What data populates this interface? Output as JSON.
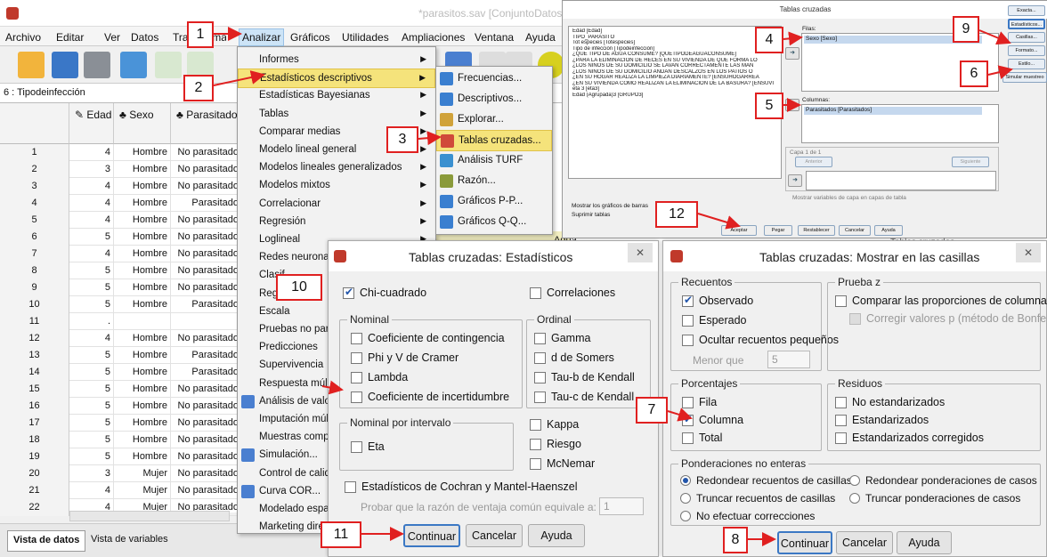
{
  "spss": {
    "title": "*parasitos.sav [ConjuntoDatos1] - IBM S",
    "menu": [
      "Archivo",
      "Editar",
      "Ver",
      "Datos",
      "Transformar",
      "Analizar",
      "Gráficos",
      "Utilidades",
      "Ampliaciones",
      "Ventana",
      "Ayuda"
    ],
    "var_ref": "6 : Tipodeinfección",
    "columns": [
      "Edad",
      "Sexo",
      "Parasitado"
    ],
    "rows": [
      {
        "n": "1",
        "edad": "4",
        "sexo": "Hombre",
        "par": "No parasitado"
      },
      {
        "n": "2",
        "edad": "3",
        "sexo": "Hombre",
        "par": "No parasitado"
      },
      {
        "n": "3",
        "edad": "4",
        "sexo": "Hombre",
        "par": "No parasitado"
      },
      {
        "n": "4",
        "edad": "4",
        "sexo": "Hombre",
        "par": "Parasitado"
      },
      {
        "n": "5",
        "edad": "4",
        "sexo": "Hombre",
        "par": "No parasitado"
      },
      {
        "n": "6",
        "edad": "5",
        "sexo": "Hombre",
        "par": "No parasitado"
      },
      {
        "n": "7",
        "edad": "4",
        "sexo": "Hombre",
        "par": "No parasitado"
      },
      {
        "n": "8",
        "edad": "5",
        "sexo": "Hombre",
        "par": "No parasitado"
      },
      {
        "n": "9",
        "edad": "5",
        "sexo": "Hombre",
        "par": "No parasitado"
      },
      {
        "n": "10",
        "edad": "5",
        "sexo": "Hombre",
        "par": "Parasitado"
      },
      {
        "n": "11",
        "edad": ".",
        "sexo": "",
        "par": ""
      },
      {
        "n": "12",
        "edad": "4",
        "sexo": "Hombre",
        "par": "No parasitado"
      },
      {
        "n": "13",
        "edad": "5",
        "sexo": "Hombre",
        "par": "Parasitado"
      },
      {
        "n": "14",
        "edad": "5",
        "sexo": "Hombre",
        "par": "Parasitado"
      },
      {
        "n": "15",
        "edad": "5",
        "sexo": "Hombre",
        "par": "No parasitado"
      },
      {
        "n": "16",
        "edad": "5",
        "sexo": "Hombre",
        "par": "No parasitado"
      },
      {
        "n": "17",
        "edad": "5",
        "sexo": "Hombre",
        "par": "No parasitado"
      },
      {
        "n": "18",
        "edad": "5",
        "sexo": "Hombre",
        "par": "No parasitado"
      },
      {
        "n": "19",
        "edad": "5",
        "sexo": "Hombre",
        "par": "No parasitado"
      },
      {
        "n": "20",
        "edad": "3",
        "sexo": "Mujer",
        "par": "No parasitado"
      },
      {
        "n": "21",
        "edad": "4",
        "sexo": "Mujer",
        "par": "No parasitado"
      },
      {
        "n": "22",
        "edad": "4",
        "sexo": "Mujer",
        "par": "No parasitado"
      }
    ],
    "tabs": {
      "data": "Vista de datos",
      "vars": "Vista de variables"
    },
    "right_col": [
      "a",
      "a",
      "a",
      "a",
      "Agua"
    ]
  },
  "menu_analizar": [
    {
      "label": "Informes",
      "arrow": true
    },
    {
      "label": "Estadísticos descriptivos",
      "arrow": true,
      "hl": true
    },
    {
      "label": "Estadísticas Bayesianas",
      "arrow": true
    },
    {
      "label": "Tablas",
      "arrow": true
    },
    {
      "label": "Comparar medias",
      "arrow": true
    },
    {
      "label": "Modelo lineal general",
      "arrow": true
    },
    {
      "label": "Modelos lineales generalizados",
      "arrow": true
    },
    {
      "label": "Modelos mixtos",
      "arrow": true
    },
    {
      "label": "Correlacionar",
      "arrow": true
    },
    {
      "label": "Regresión",
      "arrow": true
    },
    {
      "label": "Loglineal",
      "arrow": true
    },
    {
      "label": "Redes neurona",
      "arrow": false
    },
    {
      "label": "Clasif",
      "arrow": false
    },
    {
      "label": "Reg",
      "arrow": false
    },
    {
      "label": "Escala",
      "arrow": false
    },
    {
      "label": "Pruebas no par",
      "arrow": false
    },
    {
      "label": "Predicciones",
      "arrow": false
    },
    {
      "label": "Supervivencia",
      "arrow": false
    },
    {
      "label": "Respuesta múlt",
      "arrow": false
    },
    {
      "label": "Análisis de valor",
      "arrow": false,
      "icon": true
    },
    {
      "label": "Imputación múlt",
      "arrow": false
    },
    {
      "label": "Muestras compl",
      "arrow": false
    },
    {
      "label": "Simulación...",
      "arrow": false,
      "icon": true
    },
    {
      "label": "Control de calid",
      "arrow": false
    },
    {
      "label": "Curva COR...",
      "arrow": false,
      "icon": true
    },
    {
      "label": "Modelado espa",
      "arrow": false
    },
    {
      "label": "Marketing dire",
      "arrow": false
    }
  ],
  "submenu": [
    {
      "label": "Frecuencias..."
    },
    {
      "label": "Descriptivos..."
    },
    {
      "label": "Explorar..."
    },
    {
      "label": "Tablas cruzadas...",
      "hl": true
    },
    {
      "label": "Análisis TURF"
    },
    {
      "label": "Razón..."
    },
    {
      "label": "Gráficos P-P..."
    },
    {
      "label": "Gráficos Q-Q..."
    }
  ],
  "dlg_main": {
    "title": "Tablas cruzadas",
    "variables": [
      "Edad [Edad]",
      "TIPO_PARASITO",
      "Tot especies [Totespecies]",
      "Tipo de infección [Tipodeinfección]",
      "¿QUÉ TIPO DE AGUA CONSUME? [QUETIPODEAGUACONSUME]",
      "¿PARA LA ELIMINACIÓN DE HECES EN SU VIVIENDA DE QUE FORMA LO",
      "¿LOS NIÑOS DE SU DOMICILIO SE LAVAN CORRECTAMENTE LAS MAN",
      "¿LOS NIÑOS DE SU DOMICILIO ANDAN DESCALZOS EN LOS PATIOS O",
      "¿EN SU HOGAR REALIZA LA LIMPIEZA DIARIAMENTE? [ENSUHOGARREA",
      "¿EN SU VIVIENDA COMO REALIZAN LA ELIMINACION DE LA BASURA? [ENSUVI",
      "eta 3 [eta3]",
      "Edad (Agrupada)3 [GRUPO3]"
    ],
    "filas_label": "Filas:",
    "fila_item": "Sexo [Sexo]",
    "columnas_label": "Columnas:",
    "columna_item": "Parasitados [Parasitados]",
    "capa": "Capa 1 de 1",
    "anterior": "Anterior",
    "siguiente": "Siguiente",
    "mostrar_capa": "Mostrar variables de capa en capas de tabla",
    "mostrar_graficos": "Mostrar los gráficos de barras",
    "suprimir": "Suprimir tablas",
    "side_buttons": [
      "Exacta...",
      "Estadísticos...",
      "Casillas...",
      "Formato...",
      "Estilo...",
      "Simular muestreo"
    ],
    "bottom_buttons": [
      "Aceptar",
      "Pegar",
      "Restablecer",
      "Cancelar",
      "Ayuda"
    ]
  },
  "dlg_est": {
    "title": "Tablas cruzadas: Estadísticos",
    "chi": "Chi-cuadrado",
    "correl": "Correlaciones",
    "nominal": "Nominal",
    "nominal_items": [
      "Coeficiente de contingencia",
      "Phi y V de Cramer",
      "Lambda",
      "Coeficiente de incertidumbre"
    ],
    "ordinal": "Ordinal",
    "ordinal_items": [
      "Gamma",
      "d de Somers",
      "Tau-b de Kendall",
      "Tau-c de Kendall"
    ],
    "intervalo": "Nominal por intervalo",
    "eta": "Eta",
    "extra_items": [
      "Kappa",
      "Riesgo",
      "McNemar"
    ],
    "cochran": "Estadísticos de Cochran y Mantel-Haenszel",
    "probar": "Probar que la razón de ventaja común equivale a:",
    "probar_val": "1",
    "buttons": [
      "Continuar",
      "Cancelar",
      "Ayuda"
    ]
  },
  "dlg_cas": {
    "title": "Tablas cruzadas: Mostrar en las casillas",
    "behind_title": "Tablas cruzadas",
    "recuentos": "Recuentos",
    "observado": "Observado",
    "esperado": "Esperado",
    "ocultar": "Ocultar recuentos pequeños",
    "menor_que": "Menor que",
    "menor_val": "5",
    "pruebaz": "Prueba z",
    "comparar": "Comparar las proporciones de columna",
    "corregir": "Corregir valores p (método de Bonferroni)",
    "porcentajes": "Porcentajes",
    "fila": "Fila",
    "columna": "Columna",
    "total": "Total",
    "residuos": "Residuos",
    "res_items": [
      "No estandarizados",
      "Estandarizados",
      "Estandarizados corregidos"
    ],
    "ponderaciones": "Ponderaciones no enteras",
    "radios": [
      "Redondear recuentos de casillas",
      "Redondear ponderaciones de casos",
      "Truncar recuentos de casillas",
      "Truncar ponderaciones de casos",
      "No efectuar correcciones"
    ],
    "buttons": [
      "Continuar",
      "Cancelar",
      "Ayuda"
    ]
  },
  "callouts": [
    "1",
    "2",
    "3",
    "4",
    "5",
    "6",
    "7",
    "8",
    "9",
    "10",
    "11",
    "12"
  ],
  "colors": {
    "highlight": "#f5e37b",
    "callout": "#e02020",
    "focus": "#3b78c4"
  }
}
